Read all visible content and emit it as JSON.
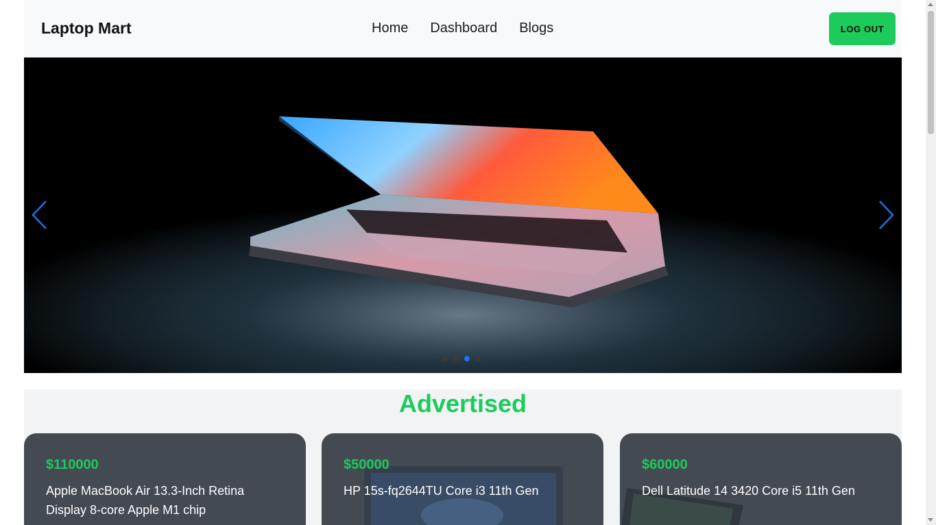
{
  "navbar": {
    "brand": "Laptop Mart",
    "links": [
      "Home",
      "Dashboard",
      "Blogs"
    ],
    "logout_label": "LOG OUT",
    "accent_color": "#1ccb5b"
  },
  "carousel": {
    "slide_count": 4,
    "active_slide": 3,
    "prev_icon": "chevron-left-icon",
    "next_icon": "chevron-right-icon",
    "arrow_color": "#1a73e8"
  },
  "advertised": {
    "title": "Advertised",
    "cards": [
      {
        "price": "$110000",
        "name": "Apple MacBook Air 13.3-Inch Retina Display 8-core Apple M1 chip"
      },
      {
        "price": "$50000",
        "name": "HP 15s-fq2644TU Core i3 11th Gen"
      },
      {
        "price": "$60000",
        "name": "Dell Latitude 14 3420 Core i5 11th Gen"
      }
    ]
  }
}
